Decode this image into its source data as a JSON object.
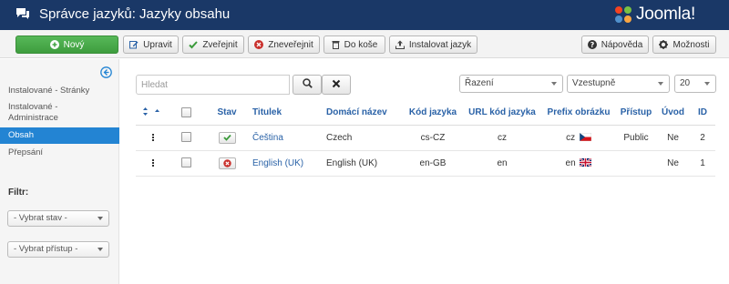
{
  "header": {
    "title": "Správce jazyků: Jazyky obsahu",
    "logo_text": "Joomla!"
  },
  "toolbar": {
    "new": "Nový",
    "edit": "Upravit",
    "publish": "Zveřejnit",
    "unpublish": "Zneveřejnit",
    "trash": "Do koše",
    "install": "Instalovat jazyk",
    "help": "Nápověda",
    "options": "Možnosti"
  },
  "sidebar": {
    "items": [
      {
        "label": "Instalované - Stránky"
      },
      {
        "label": "Instalované - Administrace"
      },
      {
        "label": "Obsah"
      },
      {
        "label": "Přepsání"
      }
    ],
    "filter_label": "Filtr:",
    "state_select": "- Vybrat stav -",
    "access_select": "- Vybrat přístup -"
  },
  "search": {
    "placeholder": "Hledat"
  },
  "list_controls": {
    "ordering": "Řazení",
    "direction": "Vzestupně",
    "limit": "20"
  },
  "table": {
    "columns": {
      "state": "Stav",
      "title": "Titulek",
      "native": "Domácí název",
      "code": "Kód jazyka",
      "url": "URL kód jazyka",
      "image": "Prefix obrázku",
      "access": "Přístup",
      "home": "Úvod",
      "id": "ID"
    },
    "rows": [
      {
        "title": "Čeština",
        "native": "Czech",
        "code": "cs-CZ",
        "url": "cz",
        "image": "cz",
        "access": "Public",
        "home": "Ne",
        "id": "2",
        "published": true
      },
      {
        "title": "English (UK)",
        "native": "English (UK)",
        "code": "en-GB",
        "url": "en",
        "image": "en",
        "access": "",
        "home": "Ne",
        "id": "1",
        "published": false
      }
    ]
  },
  "colors": {
    "header_bg": "#1a3867",
    "accent": "#2a62a7",
    "active_item": "#2384d3",
    "new_button": "#46a546",
    "unpublish_red": "#c9302c",
    "publish_green": "#3a9a3a"
  },
  "icons": [
    "comments-icon",
    "joomla-logo",
    "plus-circle-icon",
    "edit-icon",
    "check-icon",
    "times-circle-icon",
    "trash-icon",
    "upload-icon",
    "question-circle-icon",
    "gear-icon",
    "arrow-left-circle-icon",
    "search-icon",
    "close-icon",
    "sort-icon",
    "drag-handle-icon",
    "cz-flag-icon",
    "uk-flag-icon"
  ]
}
